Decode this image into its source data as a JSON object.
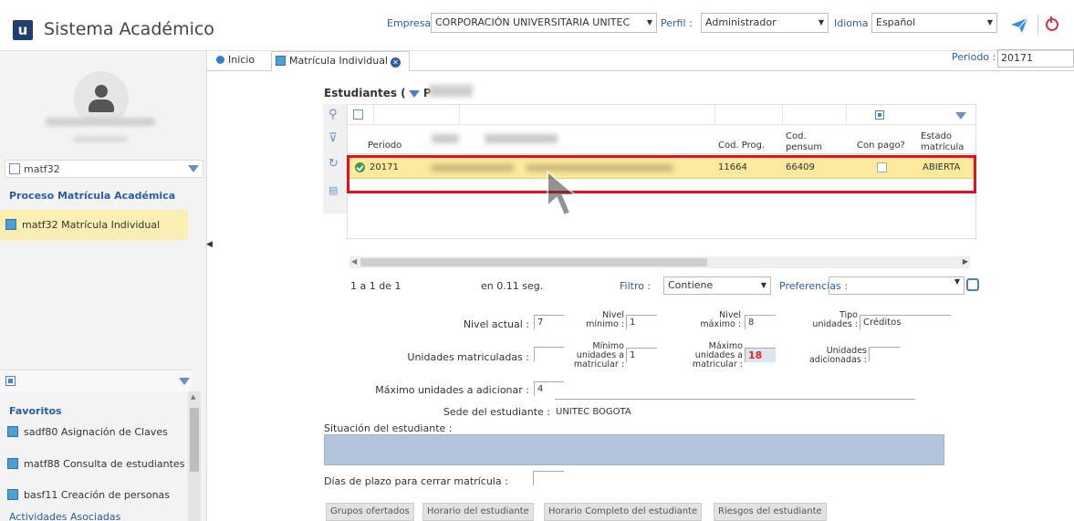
{
  "header": {
    "app_title": "Sistema Académico",
    "logo_letter": "u",
    "empresa_label": "Empresa :",
    "empresa_value": "CORPORACIÓN UNIVERSITARIA UNITEC",
    "perfil_label": "Perfil :",
    "perfil_value": "Administrador",
    "idioma_label": "Idioma :",
    "idioma_value": "Español"
  },
  "sidebar": {
    "menu_search_value": "matf32",
    "menu_group": "Proceso Matrícula Académica",
    "menu_item": "matf32  Matrícula Individual",
    "favorites_title": "Favoritos",
    "favorites": [
      {
        "label": "sadf80  Asignación de Claves"
      },
      {
        "label": "matf88  Consulta de estudiantes"
      },
      {
        "label": "basf11  Creación de personas"
      }
    ],
    "cutoff_label": "Actividades Asociadas"
  },
  "tabs": {
    "inicio": "Inicio",
    "matricula": "Matrícula Individual"
  },
  "periodo": {
    "label": "Periodo :",
    "value": "20171"
  },
  "grid": {
    "title": "Estudiantes (",
    "title_suffix": "P",
    "columns": {
      "periodo": "Periodo",
      "cod_prog": "Cod. Prog.",
      "cod_pensum_1": "Cod.",
      "cod_pensum_2": "pensum",
      "con_pago": "Con pago?",
      "estado_1": "Estado",
      "estado_2": "matrícula"
    },
    "row": {
      "periodo": "20171",
      "cod_prog": "11664",
      "cod_pensum": "66409",
      "estado": "ABIERTA"
    }
  },
  "pager": {
    "count": "1 a 1 de 1",
    "time": "en 0.11 seg.",
    "filtro_label": "Filtro :",
    "filtro_value": "Contiene",
    "pref_label": "Preferencias :"
  },
  "form": {
    "nivel_actual_label": "Nivel actual :",
    "nivel_actual": "7",
    "nivel_minimo_1": "Nivel",
    "nivel_minimo_2": "mínimo :",
    "nivel_minimo": "1",
    "nivel_maximo_1": "Nivel",
    "nivel_maximo_2": "máximo :",
    "nivel_maximo": "8",
    "tipo_unidades_1": "Tipo",
    "tipo_unidades_2": "unidades :",
    "tipo_unidades": "Créditos",
    "unidades_matriculadas_label": "Unidades matriculadas :",
    "min_unid_1": "Mínimo",
    "min_unid_2": "unidades a",
    "min_unid_3": "matricular :",
    "min_unid": "1",
    "max_unid_1": "Máximo",
    "max_unid_2": "unidades a",
    "max_unid_3": "matricular :",
    "max_unid": "18",
    "unid_adic_1": "Unidades",
    "unid_adic_2": "adicionadas :",
    "max_adicionar_label": "Máximo unidades a adicionar :",
    "max_adicionar": "4",
    "sede_label": "Sede del estudiante :",
    "sede": "UNITEC BOGOTA",
    "situacion_label": "Situación del estudiante :",
    "dias_plazo_label": "Días de plazo para cerrar matrícula :"
  },
  "bottom_tabs": [
    "Grupos ofertados",
    "Horario del estudiante",
    "Horario Completo del estudiante",
    "Riesgos del estudiante"
  ],
  "colors": {
    "brand": "#1f3f74",
    "link": "#2a5ca8",
    "highlight_row": "#fbe99e",
    "annotation_red": "#e5101b"
  }
}
